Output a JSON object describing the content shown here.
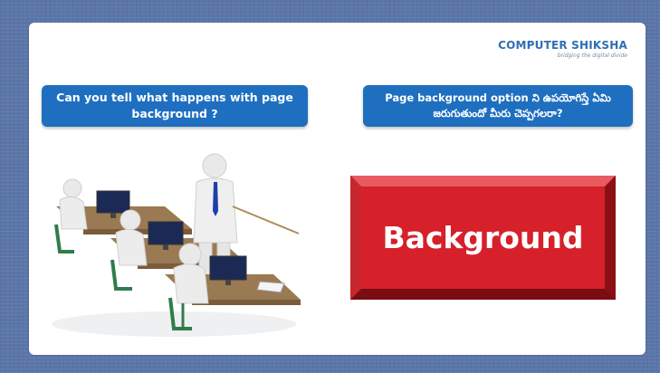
{
  "logo": {
    "text_part1": "C",
    "text_part2": "OMPUTER SHIKSHA",
    "tagline": "bridging the digital divide"
  },
  "question_en": "Can you tell what happens with page background ?",
  "question_te": "Page background option ని ఉపయోగిస్తే ఏమి జరుగుతుందో మీరు చెప్పగలరా?",
  "button_label": "Background",
  "colors": {
    "slide_background": "#5b76a8",
    "question_box": "#1f6fc0",
    "button_red": "#d6202a",
    "logo_blue": "#2f6fb3"
  },
  "illustration": {
    "icon": "classroom-computer-lab-icon"
  }
}
